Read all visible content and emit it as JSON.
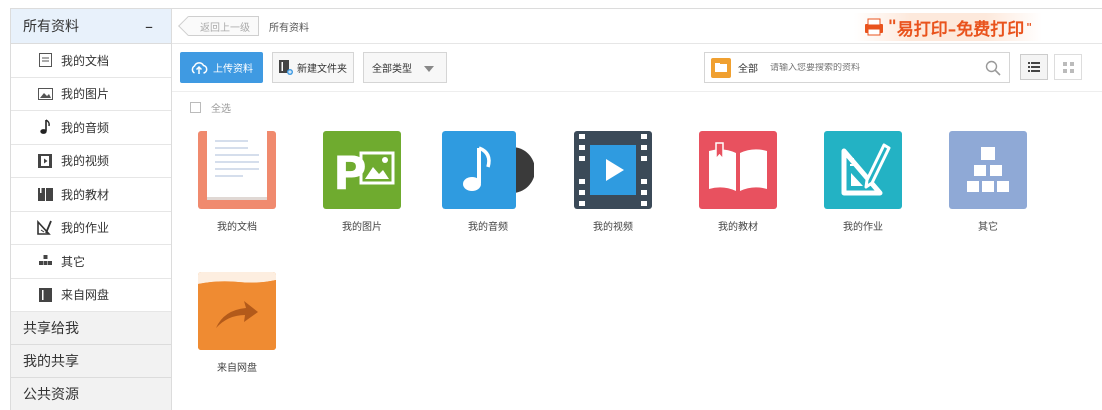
{
  "sidebar": {
    "header": {
      "label": "所有资料",
      "collapse_symbol": "–"
    },
    "items": [
      {
        "label": "我的文档",
        "icon": "document-icon"
      },
      {
        "label": "我的图片",
        "icon": "image-icon"
      },
      {
        "label": "我的音频",
        "icon": "music-icon"
      },
      {
        "label": "我的视频",
        "icon": "video-icon"
      },
      {
        "label": "我的教材",
        "icon": "book-icon"
      },
      {
        "label": "我的作业",
        "icon": "homework-icon"
      },
      {
        "label": "其它",
        "icon": "other-icon"
      },
      {
        "label": "来自网盘",
        "icon": "cloud-disk-icon"
      }
    ],
    "groups": [
      {
        "label": "共享给我"
      },
      {
        "label": "我的共享"
      },
      {
        "label": "公共资源"
      }
    ]
  },
  "topbar": {
    "back_label": "返回上一级",
    "breadcrumb": "所有资料",
    "brand": {
      "text": "易打印–免费打印",
      "accent": "#e9531d"
    }
  },
  "toolbar": {
    "upload_label": "上传资料",
    "new_folder_label": "新建文件夹",
    "type_filter": "全部类型",
    "search_scope": "全部",
    "search_placeholder": "请输入您要搜索的资料",
    "accent": "#3f9ae2"
  },
  "select_all_label": "全选",
  "tiles": [
    {
      "label": "我的文档",
      "color": "#f08a6e",
      "icon": "document-icon"
    },
    {
      "label": "我的图片",
      "color": "#6fab2f",
      "icon": "image-icon"
    },
    {
      "label": "我的音频",
      "color": "#2f9be0",
      "icon": "music-icon"
    },
    {
      "label": "我的视频",
      "color": "#3b4a58",
      "icon": "video-icon"
    },
    {
      "label": "我的教材",
      "color": "#e8515f",
      "icon": "book-icon"
    },
    {
      "label": "我的作业",
      "color": "#23b2c4",
      "icon": "homework-icon"
    },
    {
      "label": "其它",
      "color": "#8fa9d6",
      "icon": "other-icon"
    },
    {
      "label": "来自网盘",
      "color": "#ef8b32",
      "icon": "cloud-disk-icon"
    }
  ]
}
